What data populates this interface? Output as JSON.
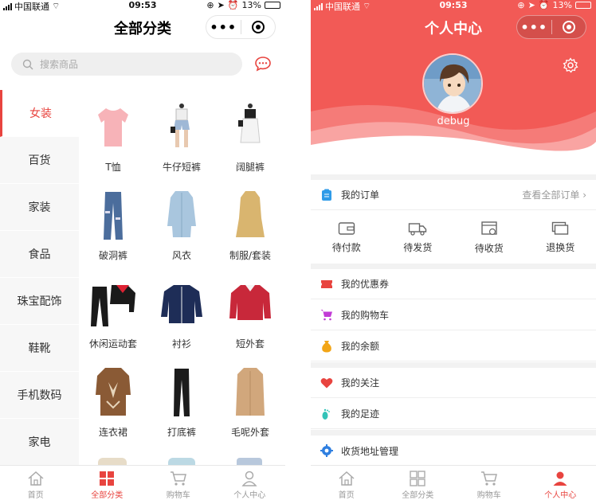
{
  "status": {
    "carrier": "中国联通",
    "time": "09:53",
    "battery": "13%"
  },
  "left": {
    "title": "全部分类",
    "search_placeholder": "搜索商品",
    "categories": [
      {
        "label": "女装",
        "active": true
      },
      {
        "label": "百货"
      },
      {
        "label": "家装"
      },
      {
        "label": "食品"
      },
      {
        "label": "珠宝配饰"
      },
      {
        "label": "鞋靴"
      },
      {
        "label": "手机数码"
      },
      {
        "label": "家电"
      }
    ],
    "products": [
      {
        "label": "T恤"
      },
      {
        "label": "牛仔短裤"
      },
      {
        "label": "阔腿裤"
      },
      {
        "label": "破洞裤"
      },
      {
        "label": "风衣"
      },
      {
        "label": "制服/套装"
      },
      {
        "label": "休闲运动套"
      },
      {
        "label": "衬衫"
      },
      {
        "label": "短外套"
      },
      {
        "label": "连衣裙"
      },
      {
        "label": "打底裤"
      },
      {
        "label": "毛呢外套"
      }
    ],
    "tabs": [
      "首页",
      "全部分类",
      "购物车",
      "个人中心"
    ],
    "active_tab": "全部分类"
  },
  "right": {
    "title": "个人中心",
    "username": "debug",
    "orders_title": "我的订单",
    "orders_all": "查看全部订单",
    "order_items": [
      "待付款",
      "待发货",
      "待收货",
      "退换货"
    ],
    "menu": [
      "我的优惠券",
      "我的购物车",
      "我的余额",
      "我的关注",
      "我的足迹",
      "收货地址管理"
    ],
    "tabs": [
      "首页",
      "全部分类",
      "购物车",
      "个人中心"
    ],
    "active_tab": "个人中心"
  },
  "colors": {
    "accent": "#e8443f",
    "header_red": "#f25a56"
  }
}
